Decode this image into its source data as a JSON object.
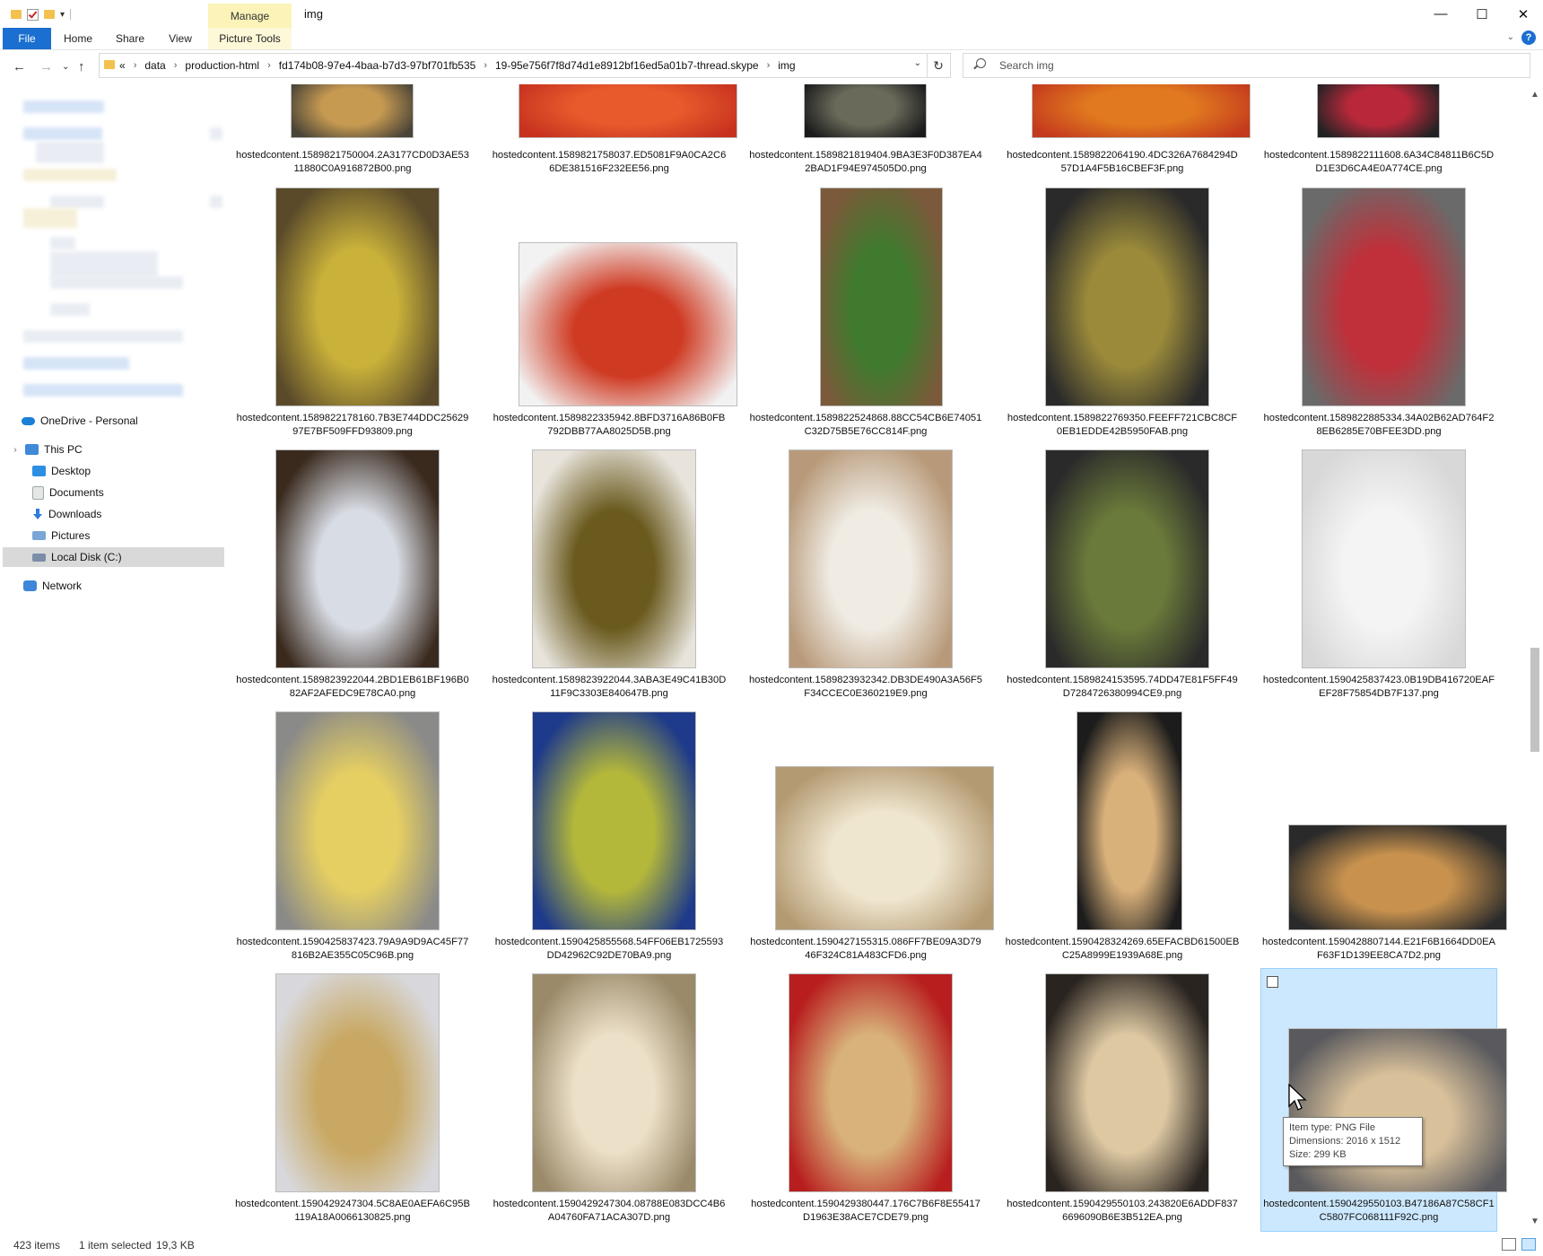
{
  "window": {
    "title": "img",
    "minimize": "—",
    "maximize": "☐",
    "close": "✕"
  },
  "ribbon": {
    "contextual_tab": "Manage",
    "tabs": [
      "File",
      "Home",
      "Share",
      "View",
      "Picture Tools"
    ],
    "help": "?"
  },
  "address": {
    "overflow": "«",
    "crumbs": [
      "data",
      "production-html",
      "fd174b08-97e4-4baa-b7d3-97bf701fb535",
      "19-95e756f7f8d74d1e8912bf16ed5a01b7-thread.skype",
      "img"
    ]
  },
  "search": {
    "placeholder": "Search img"
  },
  "sidebar": {
    "onedrive": "OneDrive - Personal",
    "this_pc": "This PC",
    "items": [
      "Desktop",
      "Documents",
      "Downloads",
      "Pictures",
      "Local Disk (C:)"
    ],
    "network": "Network"
  },
  "files": [
    {
      "name": "hostedcontent.1589821750004.2A3177CD0D3AE5311880C0A916872B00.png",
      "colors": [
        "#4a4438",
        "#c79a52"
      ]
    },
    {
      "name": "hostedcontent.1589821758037.ED5081F9A0CA2C66DE381516F232EE56.png",
      "colors": [
        "#c7321f",
        "#e85a2c"
      ]
    },
    {
      "name": "hostedcontent.1589821819404.9BA3E3F0D387EA42BAD1F94E974505D0.png",
      "colors": [
        "#1b1b1d",
        "#6a6a5a"
      ]
    },
    {
      "name": "hostedcontent.1589822064190.4DC326A7684294D57D1A4F5B16CBEF3F.png",
      "colors": [
        "#c43a1e",
        "#e0791f"
      ]
    },
    {
      "name": "hostedcontent.1589822111608.6A34C84811B6C5DD1E3D6CA4E0A774CE.png",
      "colors": [
        "#222224",
        "#b8283a"
      ]
    },
    {
      "name": "hostedcontent.1589822178160.7B3E744DDC2562997E7BF509FFD93809.png",
      "colors": [
        "#5a4a2a",
        "#c9b13a"
      ]
    },
    {
      "name": "hostedcontent.1589822335942.8BFD3716A86B0FB792DBB77AA8025D5B.png",
      "colors": [
        "#f2f2f2",
        "#cf3a22"
      ]
    },
    {
      "name": "hostedcontent.1589822524868.88CC54CB6E74051C32D75B5E76CC814F.png",
      "colors": [
        "#7a5a3a",
        "#3f7a2e"
      ]
    },
    {
      "name": "hostedcontent.1589822769350.FEEFF721CBC8CF0EB1EDDE42B5950FAB.png",
      "colors": [
        "#2a2a2a",
        "#9a8a3a"
      ]
    },
    {
      "name": "hostedcontent.1589822885334.34A02B62AD764F28EB6285E70BFEE3DD.png",
      "colors": [
        "#6a6a6a",
        "#c0303a"
      ]
    },
    {
      "name": "hostedcontent.1589823922044.2BD1EB61BF196B082AF2AFEDC9E78CA0.png",
      "colors": [
        "#3a2a1e",
        "#d8dce4"
      ]
    },
    {
      "name": "hostedcontent.1589823922044.3ABA3E49C41B30D11F9C3303E840647B.png",
      "colors": [
        "#e8e4dc",
        "#6a5a1e"
      ]
    },
    {
      "name": "hostedcontent.1589823932342.DB3DE490A3A56F5F34CCEC0E360219E9.png",
      "colors": [
        "#b89a7a",
        "#f0ece4"
      ]
    },
    {
      "name": "hostedcontent.1589824153595.74DD47E81F5FF49D7284726380994CE9.png",
      "colors": [
        "#2a2a2a",
        "#6a7a3a"
      ]
    },
    {
      "name": "hostedcontent.1590425837423.0B19DB416720EAFEF28F75854DB7F137.png",
      "colors": [
        "#d8d8d8",
        "#f4f4f4"
      ]
    },
    {
      "name": "hostedcontent.1590425837423.79A9A9D9AC45F77816B2AE355C05C96B.png",
      "colors": [
        "#8a8a88",
        "#e6cf62"
      ]
    },
    {
      "name": "hostedcontent.1590425855568.54FF06EB1725593DD42962C92DE70BA9.png",
      "colors": [
        "#1e3a8a",
        "#b4b83a"
      ]
    },
    {
      "name": "hostedcontent.1590427155315.086FF7BE09A3D7946F324C81A483CFD6.png",
      "colors": [
        "#b49a72",
        "#efe6cf"
      ]
    },
    {
      "name": "hostedcontent.1590428324269.65EFACBD61500EBC25A8999E1939A68E.png",
      "colors": [
        "#1c1c1c",
        "#d8b07a"
      ]
    },
    {
      "name": "hostedcontent.1590428807144.E21F6B1664DD0EAF63F1D139EE8CA7D2.png",
      "colors": [
        "#2a2a2a",
        "#c8924e"
      ]
    },
    {
      "name": "hostedcontent.1590429247304.5C8AE0AEFA6C95B119A18A0066130825.png",
      "colors": [
        "#d8d8dc",
        "#c8a862"
      ]
    },
    {
      "name": "hostedcontent.1590429247304.08788E083DCC4B6A04760FA71ACA307D.png",
      "colors": [
        "#9a8a6a",
        "#ece0c8"
      ]
    },
    {
      "name": "hostedcontent.1590429380447.176C7B6F8E55417D1963E38ACE7CDE79.png",
      "colors": [
        "#b81e1e",
        "#d8b27a"
      ]
    },
    {
      "name": "hostedcontent.1590429550103.243820E6ADDF8376696090B6E3B512EA.png",
      "colors": [
        "#2a2420",
        "#ddc8a2"
      ]
    },
    {
      "name": "hostedcontent.1590429550103.B47186A87C58CF1C5807FC068111F92C.png",
      "colors": [
        "#5a5a5e",
        "#d8c09a"
      ]
    }
  ],
  "tooltip": {
    "type": "Item type: PNG File",
    "dimensions": "Dimensions: 2016 x 1512",
    "size": "Size: 299 KB"
  },
  "status": {
    "count": "423 items",
    "selected": "1 item selected",
    "size": "19,3 KB"
  },
  "colors": {
    "accent": "#1a6fd0",
    "selection": "#cce8ff",
    "manage_tab": "#fbf3b7"
  }
}
